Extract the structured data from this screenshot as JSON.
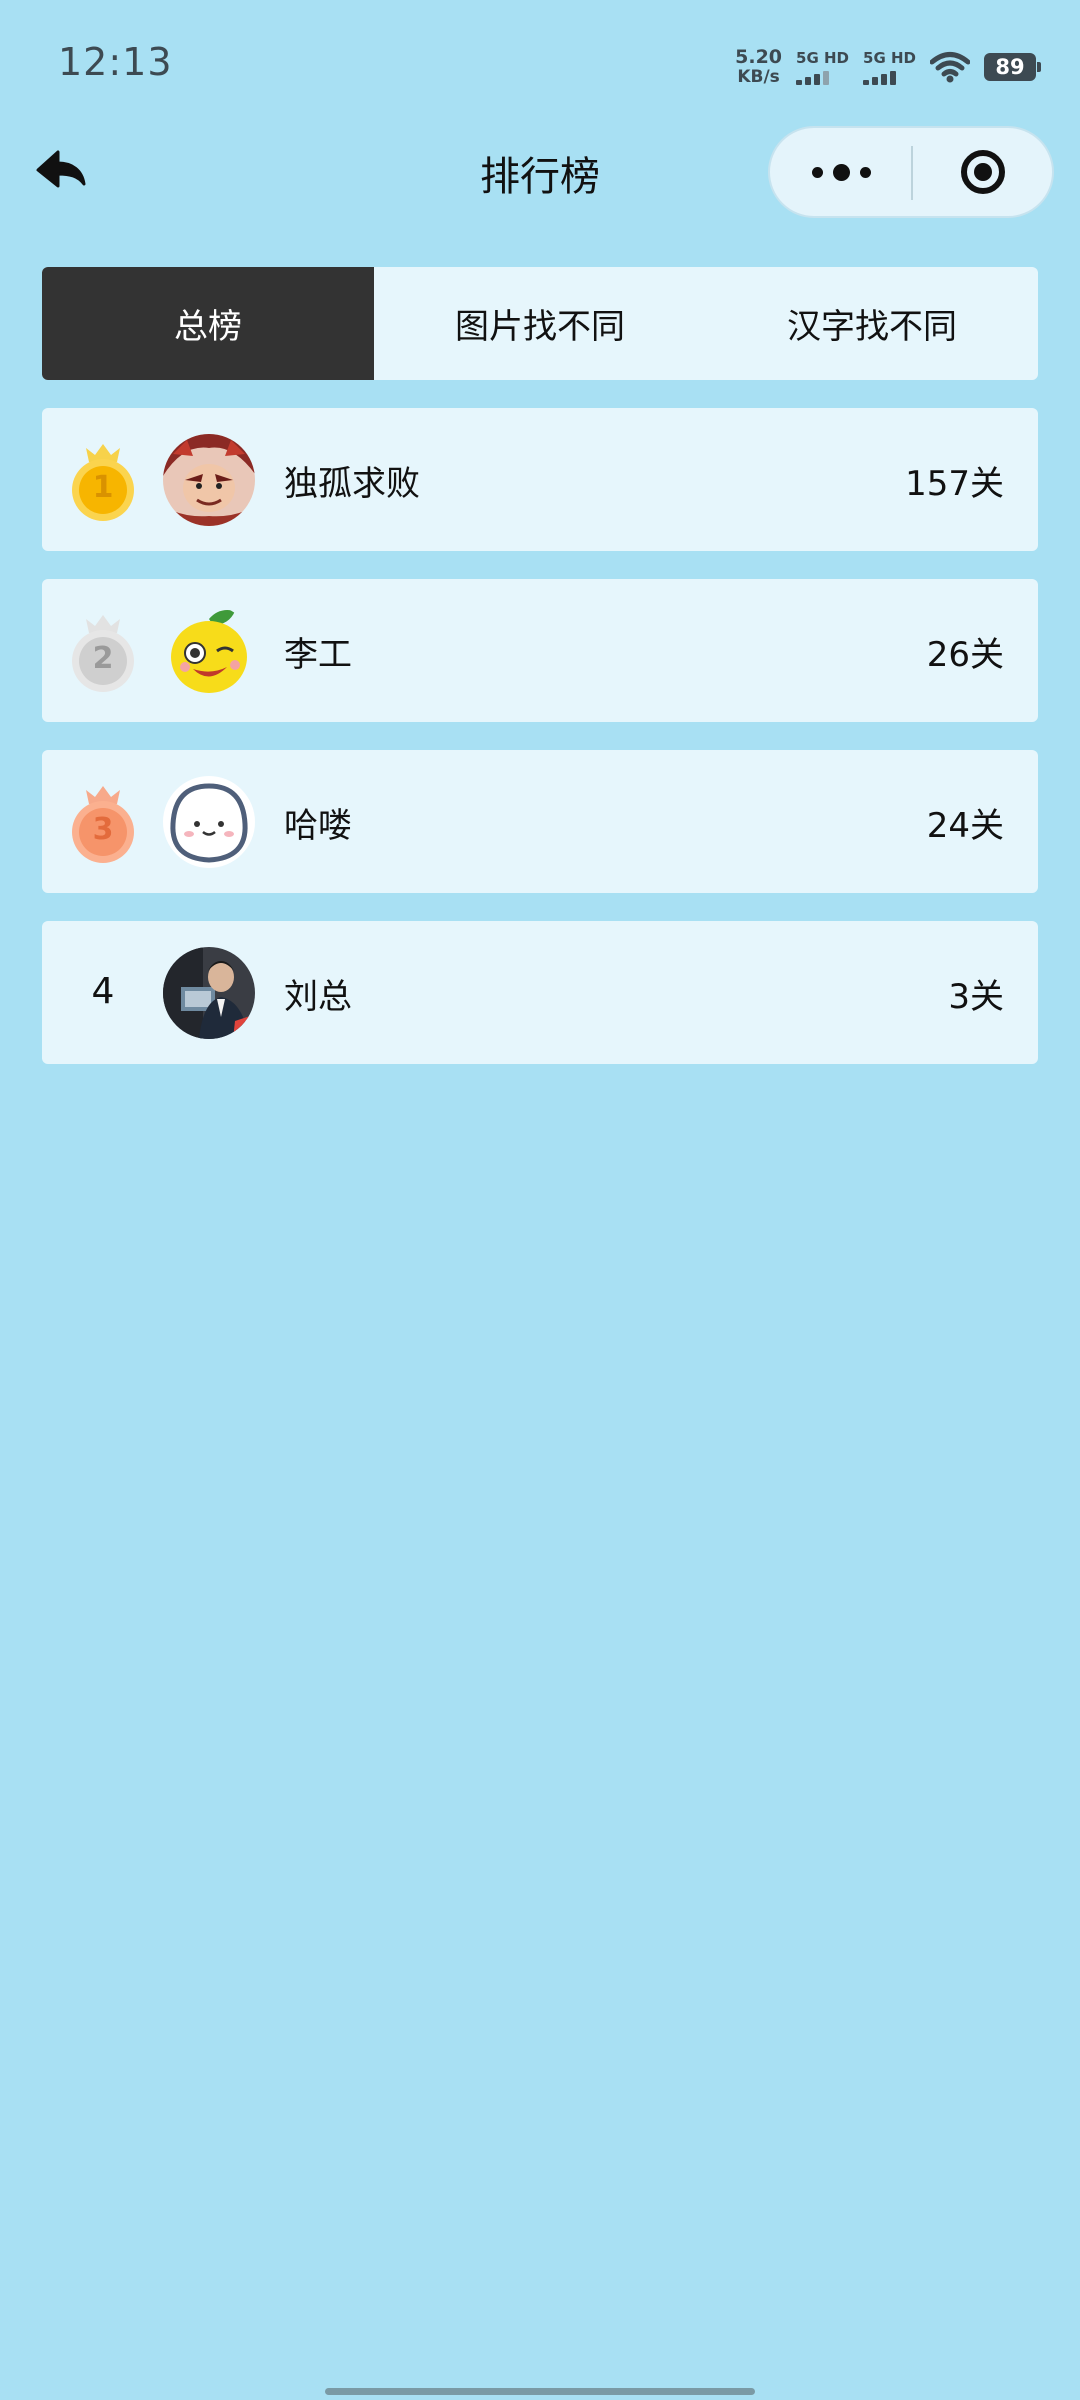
{
  "status_bar": {
    "time": "12:13",
    "net_speed_value": "5.20",
    "net_speed_unit": "KB/s",
    "sim1_label": "5G HD",
    "sim2_label": "5G HD",
    "battery": "89"
  },
  "nav": {
    "title": "排行榜"
  },
  "tabs": [
    {
      "label": "总榜",
      "active": true
    },
    {
      "label": "图片找不同",
      "active": false
    },
    {
      "label": "汉字找不同",
      "active": false
    }
  ],
  "ranking": [
    {
      "rank": "1",
      "name": "独孤求败",
      "score": "157关",
      "medal": "gold",
      "avatar": "warrior-avatar"
    },
    {
      "rank": "2",
      "name": "李工",
      "score": "26关",
      "medal": "silver",
      "avatar": "lemon-avatar"
    },
    {
      "rank": "3",
      "name": "哈喽",
      "score": "24关",
      "medal": "bronze",
      "avatar": "cute-face-avatar"
    },
    {
      "rank": "4",
      "name": "刘总",
      "score": "3关",
      "medal": "none",
      "avatar": "man-photo-avatar"
    }
  ],
  "colors": {
    "background": "#a8e0f3",
    "row_background": "#e6f6fc",
    "tab_active": "#333333",
    "gold": "#f7b500",
    "silver": "#c8c8c8",
    "bronze": "#f6946a"
  }
}
